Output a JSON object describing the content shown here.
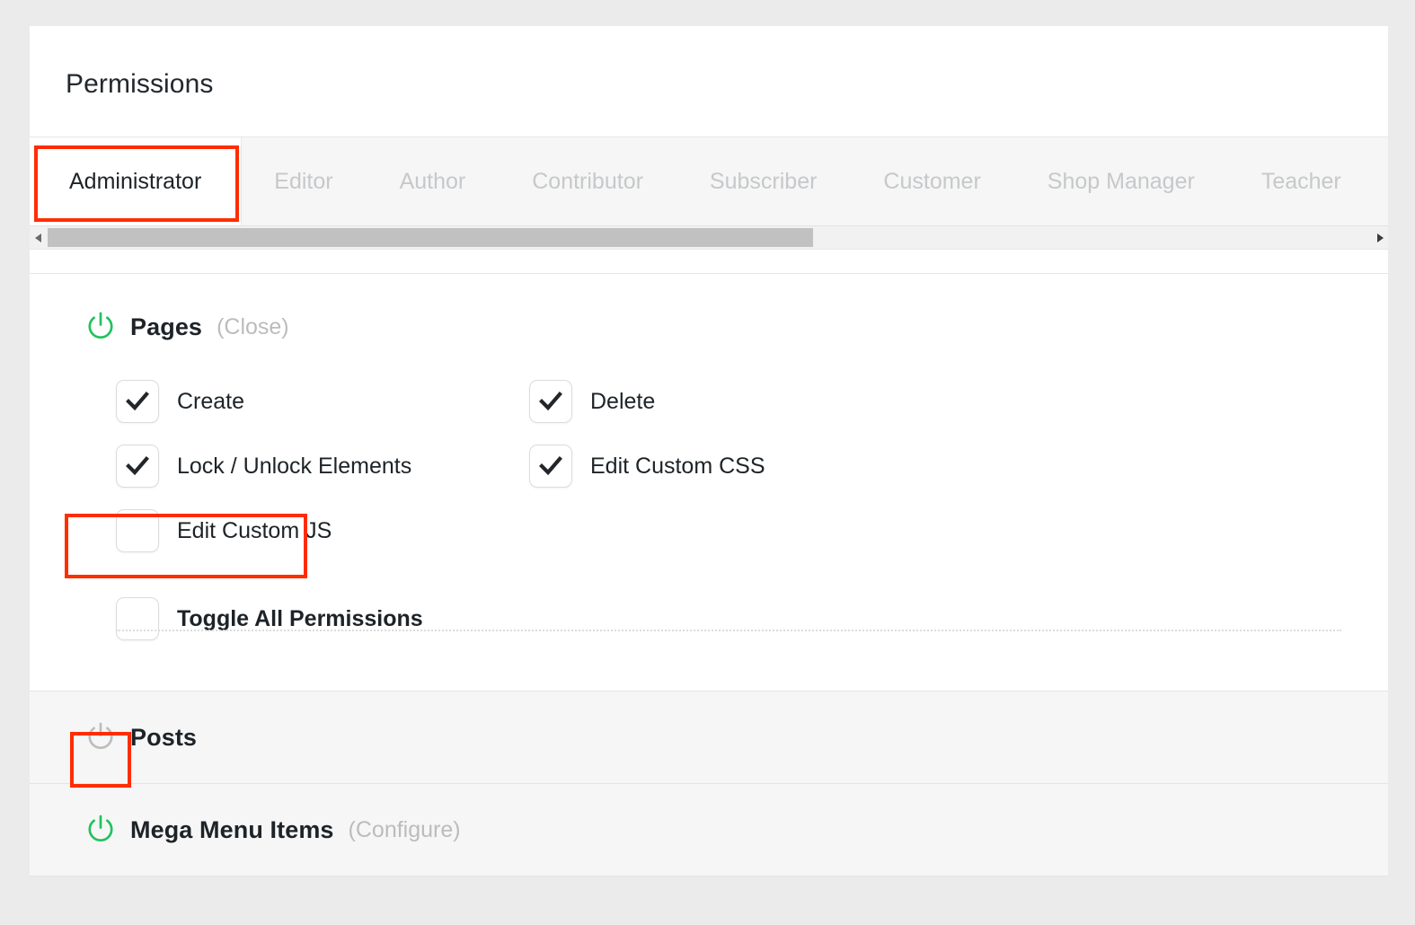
{
  "page": {
    "title": "Permissions",
    "accent_red": "#ff2d00",
    "power_on_color": "#21c25e",
    "power_off_color": "#bdbdbd"
  },
  "tabs": {
    "active": "Administrator",
    "items": [
      {
        "label": "Administrator",
        "active": true
      },
      {
        "label": "Editor",
        "active": false
      },
      {
        "label": "Author",
        "active": false
      },
      {
        "label": "Contributor",
        "active": false
      },
      {
        "label": "Subscriber",
        "active": false
      },
      {
        "label": "Customer",
        "active": false
      },
      {
        "label": "Shop Manager",
        "active": false
      },
      {
        "label": "Teacher",
        "active": false
      }
    ],
    "scrollbar": {
      "left_arrow": "scroll-left-icon",
      "right_arrow": "scroll-right-icon"
    }
  },
  "sections": [
    {
      "name": "pages",
      "title": "Pages",
      "action": "(Close)",
      "power": "on",
      "permissions": [
        {
          "label": "Create",
          "checked": true
        },
        {
          "label": "Delete",
          "checked": true
        },
        {
          "label": "Lock / Unlock Elements",
          "checked": true
        },
        {
          "label": "Edit Custom CSS",
          "checked": true
        },
        {
          "label": "Edit Custom JS",
          "checked": false
        }
      ],
      "toggle_all": {
        "label": "Toggle All Permissions",
        "checked": false
      }
    },
    {
      "name": "posts",
      "title": "Posts",
      "action": "",
      "power": "off",
      "permissions": [],
      "toggle_all": null
    },
    {
      "name": "mega",
      "title": "Mega Menu Items",
      "action": "(Configure)",
      "power": "on",
      "permissions": [],
      "toggle_all": null
    }
  ],
  "annotations": [
    {
      "name": "administrator-tab-highlight",
      "target": "Administrator tab"
    },
    {
      "name": "edit-custom-js-highlight",
      "target": "Edit Custom JS checkbox"
    },
    {
      "name": "posts-power-toggle-highlight",
      "target": "Posts power toggle"
    }
  ]
}
